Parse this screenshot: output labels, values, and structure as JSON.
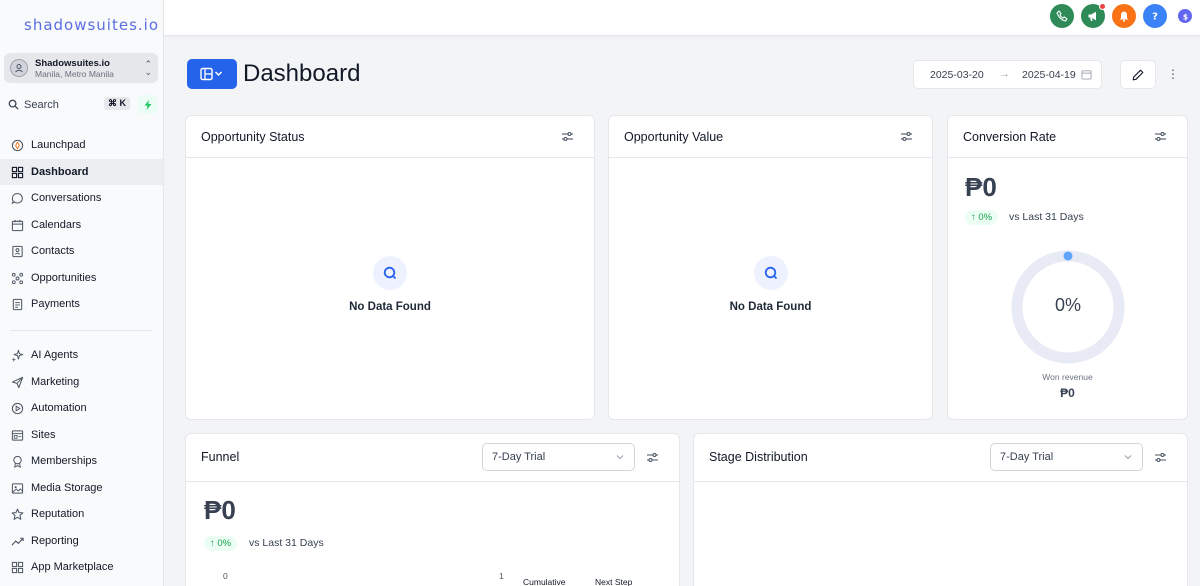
{
  "brand": {
    "logo": "shadowsuites.io"
  },
  "account": {
    "name": "Shadowsuites.io",
    "location": "Manila, Metro Manila"
  },
  "search": {
    "label": "Search",
    "shortcut": "⌘ K"
  },
  "nav": {
    "primary": [
      {
        "label": "Launchpad",
        "icon": "rocket-icon"
      },
      {
        "label": "Dashboard",
        "icon": "grid-icon",
        "active": true
      },
      {
        "label": "Conversations",
        "icon": "chat-icon"
      },
      {
        "label": "Calendars",
        "icon": "calendar-icon"
      },
      {
        "label": "Contacts",
        "icon": "contacts-icon"
      },
      {
        "label": "Opportunities",
        "icon": "opportunities-icon"
      },
      {
        "label": "Payments",
        "icon": "payments-icon"
      }
    ],
    "secondary": [
      {
        "label": "AI Agents",
        "icon": "sparkle-icon"
      },
      {
        "label": "Marketing",
        "icon": "send-icon"
      },
      {
        "label": "Automation",
        "icon": "automation-icon"
      },
      {
        "label": "Sites",
        "icon": "sites-icon"
      },
      {
        "label": "Memberships",
        "icon": "membership-icon"
      },
      {
        "label": "Media Storage",
        "icon": "image-icon"
      },
      {
        "label": "Reputation",
        "icon": "star-icon"
      },
      {
        "label": "Reporting",
        "icon": "trend-icon"
      },
      {
        "label": "App Marketplace",
        "icon": "apps-icon"
      }
    ]
  },
  "topbar": {
    "icons": [
      "phone-icon",
      "megaphone-icon",
      "bell-icon",
      "help-icon",
      "currency-icon"
    ],
    "colors": {
      "phone": "#2e8b57",
      "megaphone": "#2e8b57",
      "bell": "#f97316",
      "help": "#3b82f6",
      "currency": "#6366f1"
    }
  },
  "header": {
    "title": "Dashboard",
    "date_start": "2025-03-20",
    "date_end": "2025-04-19"
  },
  "cards": {
    "opportunity_status": {
      "title": "Opportunity Status",
      "empty": "No Data Found"
    },
    "opportunity_value": {
      "title": "Opportunity Value",
      "empty": "No Data Found"
    },
    "conversion_rate": {
      "title": "Conversion Rate",
      "value": "₱0",
      "change": "↑ 0%",
      "compare": "vs Last 31 Days",
      "gauge_pct": "0%",
      "gauge_fraction": 0,
      "won_label": "Won revenue",
      "won_value": "₱0"
    },
    "funnel": {
      "title": "Funnel",
      "pipeline": "7-Day Trial",
      "value": "₱0",
      "change": "↑ 0%",
      "compare": "vs Last 31 Days",
      "axis_start": "0",
      "axis_end": "1",
      "col_cumulative": "Cumulative",
      "col_next_step": "Next Step"
    },
    "stage_distribution": {
      "title": "Stage Distribution",
      "pipeline": "7-Day Trial"
    }
  },
  "colors": {
    "accent": "#2563eb",
    "positive": "#16a34a",
    "gauge_track": "#e8ebf5",
    "gauge_dot": "#60a5fa"
  }
}
